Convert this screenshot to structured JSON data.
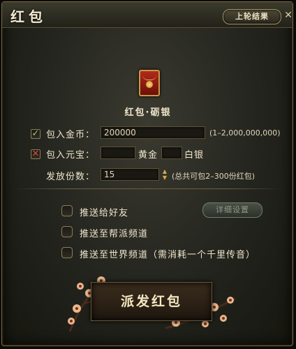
{
  "window": {
    "title": "红包",
    "last_result_label": "上轮结果",
    "close_glyph": "✕"
  },
  "header": {
    "emblem_title": "红包·砺银"
  },
  "form": {
    "gold": {
      "label": "包入金币：",
      "value": "200000",
      "range": "(1–2,000,000,000)"
    },
    "yuanbao": {
      "label": "包入元宝：",
      "gold_unit": "黄金",
      "silver_unit": "白银"
    },
    "count": {
      "label": "发放份数：",
      "value": "15",
      "hint": "(总共可包2–300份红包)"
    }
  },
  "options": [
    {
      "label": "推送给好友"
    },
    {
      "label": "推送至帮派频道"
    },
    {
      "label": "推送至世界频道（需消耗一个千里传音）"
    }
  ],
  "detail_button_label": "详细设置",
  "send_button_label": "派发红包",
  "colors": {
    "accent": "#a8925f",
    "button_bg": "#2a2015",
    "check_green": "#8fd46a",
    "check_red": "#e24a3a"
  }
}
